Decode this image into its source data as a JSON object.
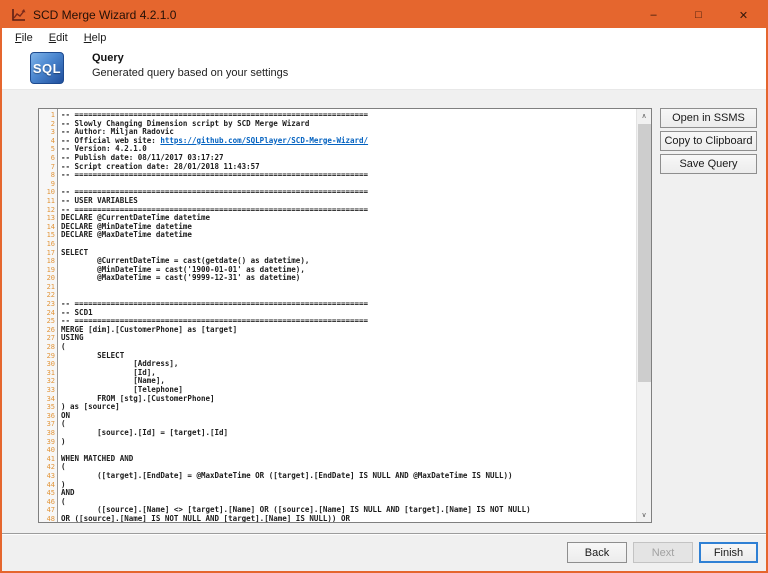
{
  "window": {
    "title": "SCD Merge Wizard 4.2.1.0",
    "accent_color": "#E5662E",
    "controls": {
      "minimize": "–",
      "maximize": "□",
      "close": "✕"
    }
  },
  "menu": {
    "items": [
      {
        "label": "File"
      },
      {
        "label": "Edit"
      },
      {
        "label": "Help"
      }
    ]
  },
  "header": {
    "logo_text": "SQL",
    "title": "Query",
    "subtitle": "Generated query based on your settings"
  },
  "side_buttons": [
    {
      "label": "Open in SSMS"
    },
    {
      "label": "Copy to Clipboard"
    },
    {
      "label": "Save Query"
    }
  ],
  "footer": {
    "back_label": "Back",
    "next_label": "Next",
    "finish_label": "Finish"
  },
  "editor": {
    "link_text": "https://github.com/SQLPlayer/SCD-Merge-Wizard/",
    "link_color": "#0563C1",
    "line_number_color": "#E2963C",
    "lines": [
      "-- =================================================================",
      "-- Slowly Changing Dimension script by SCD Merge Wizard",
      "-- Author: Miljan Radovic",
      "-- Official web site: https://github.com/SQLPlayer/SCD-Merge-Wizard/",
      "-- Version: 4.2.1.0",
      "-- Publish date: 08/11/2017 03:17:27",
      "-- Script creation date: 28/01/2018 11:43:57",
      "-- =================================================================",
      "",
      "-- =================================================================",
      "-- USER VARIABLES",
      "-- =================================================================",
      "DECLARE @CurrentDateTime datetime",
      "DECLARE @MinDateTime datetime",
      "DECLARE @MaxDateTime datetime",
      "",
      "SELECT",
      "        @CurrentDateTime = cast(getdate() as datetime),",
      "        @MinDateTime = cast('1900-01-01' as datetime),",
      "        @MaxDateTime = cast('9999-12-31' as datetime)",
      "",
      "",
      "-- =================================================================",
      "-- SCD1",
      "-- =================================================================",
      "MERGE [dim].[CustomerPhone] as [target]",
      "USING",
      "(",
      "        SELECT",
      "                [Address],",
      "                [Id],",
      "                [Name],",
      "                [Telephone]",
      "        FROM [stg].[CustomerPhone]",
      ") as [source]",
      "ON",
      "(",
      "        [source].[Id] = [target].[Id]",
      ")",
      "",
      "WHEN MATCHED AND",
      "(",
      "        ([target].[EndDate] = @MaxDateTime OR ([target].[EndDate] IS NULL AND @MaxDateTime IS NULL))",
      ")",
      "AND",
      "(",
      "        ([source].[Name] <> [target].[Name] OR ([source].[Name] IS NULL AND [target].[Name] IS NOT NULL)",
      "OR ([source].[Name] IS NOT NULL AND [target].[Name] IS NULL)) OR"
    ]
  }
}
